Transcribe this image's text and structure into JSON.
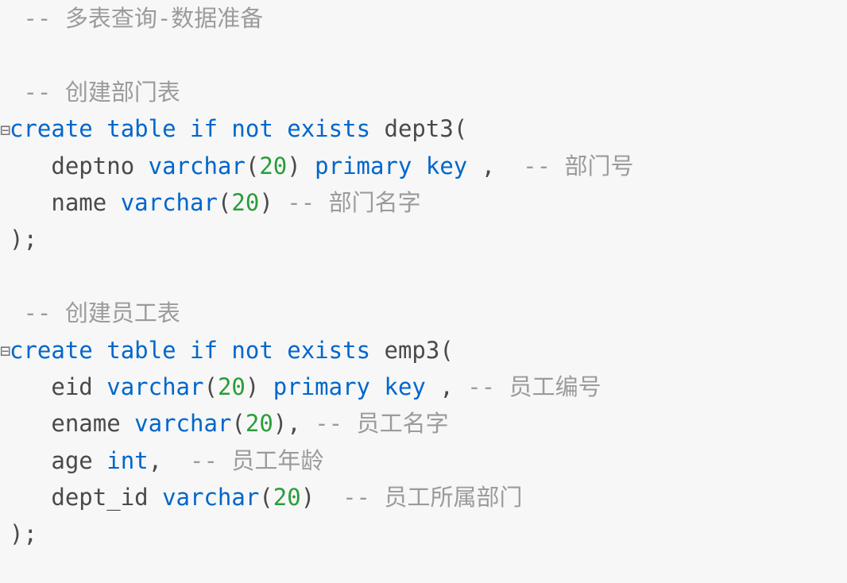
{
  "code": {
    "line1": {
      "comment": "-- 多表查询-数据准备"
    },
    "line3": {
      "comment": "-- 创建部门表"
    },
    "line4": {
      "kw_create": "create",
      "kw_table": "table",
      "kw_if": "if",
      "kw_not": "not",
      "kw_exists": "exists",
      "ident": "dept3",
      "paren": "("
    },
    "line5": {
      "ident": "deptno",
      "dtype": "varchar",
      "paren_open": "(",
      "num": "20",
      "paren_close": ")",
      "kw_primary": "primary",
      "kw_key": "key",
      "comma": ",",
      "comment": "-- 部门号"
    },
    "line6": {
      "ident": "name",
      "dtype": "varchar",
      "paren_open": "(",
      "num": "20",
      "paren_close": ")",
      "comment": "-- 部门名字"
    },
    "line7": {
      "close": ");"
    },
    "line9": {
      "comment": "-- 创建员工表"
    },
    "line10": {
      "kw_create": "create",
      "kw_table": "table",
      "kw_if": "if",
      "kw_not": "not",
      "kw_exists": "exists",
      "ident": "emp3",
      "paren": "("
    },
    "line11": {
      "ident": "eid",
      "dtype": "varchar",
      "paren_open": "(",
      "num": "20",
      "paren_close": ")",
      "kw_primary": "primary",
      "kw_key": "key",
      "comma": ",",
      "comment": "-- 员工编号"
    },
    "line12": {
      "ident": "ename",
      "dtype": "varchar",
      "paren_open": "(",
      "num": "20",
      "paren_close": ")",
      "comma": ",",
      "comment": "-- 员工名字"
    },
    "line13": {
      "ident": "age",
      "dtype": "int",
      "comma": ",",
      "comment": "-- 员工年龄"
    },
    "line14": {
      "ident": "dept_id",
      "dtype": "varchar",
      "paren_open": "(",
      "num": "20",
      "paren_close": ")",
      "comment": "-- 员工所属部门"
    },
    "line15": {
      "close": ");"
    }
  },
  "fold": {
    "collapse": "⊟",
    "none": " "
  }
}
